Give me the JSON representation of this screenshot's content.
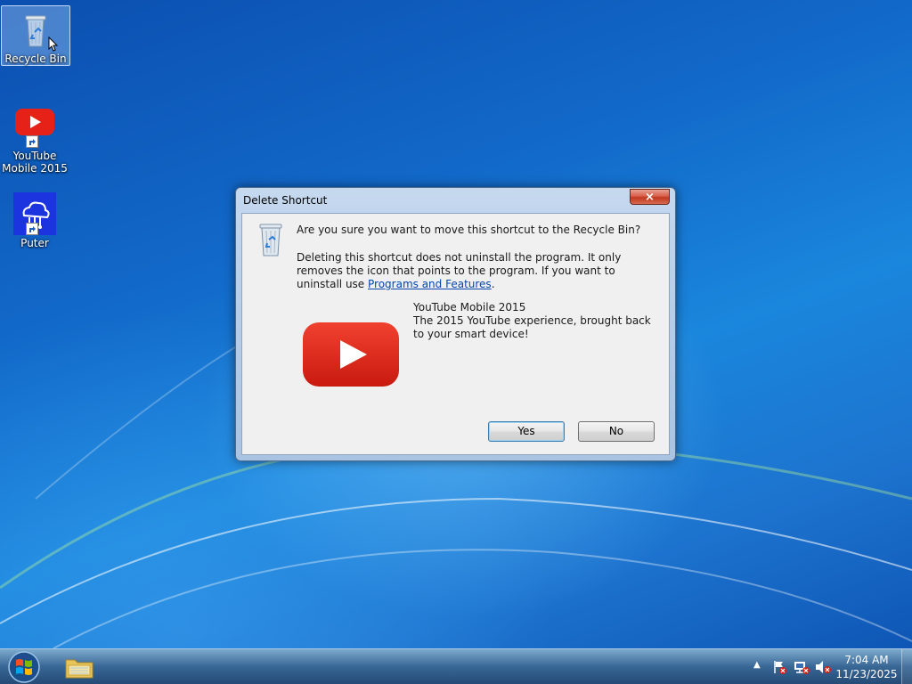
{
  "desktop": {
    "icons": [
      {
        "label": "Recycle Bin"
      },
      {
        "label": "YouTube Mobile 2015"
      },
      {
        "label": "Puter"
      }
    ]
  },
  "dialog": {
    "title": "Delete Shortcut",
    "close_label": "×",
    "question": "Are you sure you want to move this shortcut to the Recycle Bin?",
    "explain_text": "Deleting this shortcut does not uninstall the program. It only removes the icon that points to the program. If you want to uninstall use ",
    "link_text": "Programs and Features",
    "explain_end": ".",
    "item_name": "YouTube Mobile 2015",
    "item_description": "The 2015 YouTube experience, brought back to your smart device!",
    "yes_label": "Yes",
    "no_label": "No"
  },
  "taskbar": {
    "time": "7:04 AM",
    "date": "11/23/2025",
    "tray_overflow": "▲"
  },
  "colors": {
    "youtube_red": "#e62117",
    "link_blue": "#0645ad",
    "puter_blue": "#1b34e0"
  }
}
